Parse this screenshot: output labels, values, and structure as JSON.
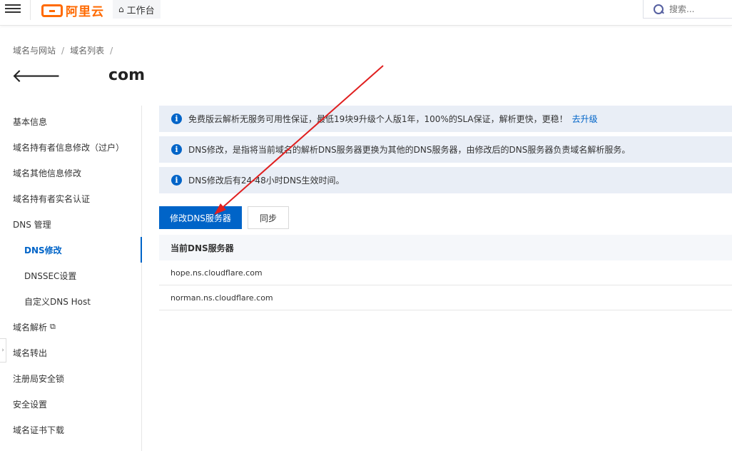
{
  "topbar": {
    "brand": "阿里云",
    "workbench_label": "工作台",
    "search_placeholder": "搜索..."
  },
  "breadcrumb": [
    "域名与网站",
    "域名列表"
  ],
  "page_title": "com",
  "sidebar": {
    "items": [
      {
        "label": "基本信息"
      },
      {
        "label": "域名持有者信息修改（过户）"
      },
      {
        "label": "域名其他信息修改"
      },
      {
        "label": "域名持有者实名认证"
      },
      {
        "label": "DNS 管理"
      },
      {
        "label": "DNS修改"
      },
      {
        "label": "DNSSEC设置"
      },
      {
        "label": "自定义DNS Host"
      },
      {
        "label": "域名解析"
      },
      {
        "label": "域名转出"
      },
      {
        "label": "注册局安全锁"
      },
      {
        "label": "安全设置"
      },
      {
        "label": "域名证书下载"
      }
    ]
  },
  "notices": [
    {
      "text": "免费版云解析无服务可用性保证，最低19块9升级个人版1年，100%的SLA保证，解析更快，更稳！",
      "link": "去升级"
    },
    {
      "text": "DNS修改，是指将当前域名的解析DNS服务器更换为其他的DNS服务器，由修改后的DNS服务器负责域名解析服务。"
    },
    {
      "text": "DNS修改后有24-48小时DNS生效时间。"
    }
  ],
  "actions": {
    "modify_label": "修改DNS服务器",
    "sync_label": "同步"
  },
  "table": {
    "header": "当前DNS服务器",
    "rows": [
      "hope.ns.cloudflare.com",
      "norman.ns.cloudflare.com"
    ]
  },
  "colors": {
    "brand": "#ff6a00",
    "primary": "#0064c8",
    "notice_bg": "#e9eef6",
    "annotation_arrow": "#e02020"
  },
  "icons": {
    "info": "info-icon",
    "home": "home-icon",
    "search": "search-icon",
    "back": "back-arrow-icon",
    "external": "external-link-icon"
  }
}
